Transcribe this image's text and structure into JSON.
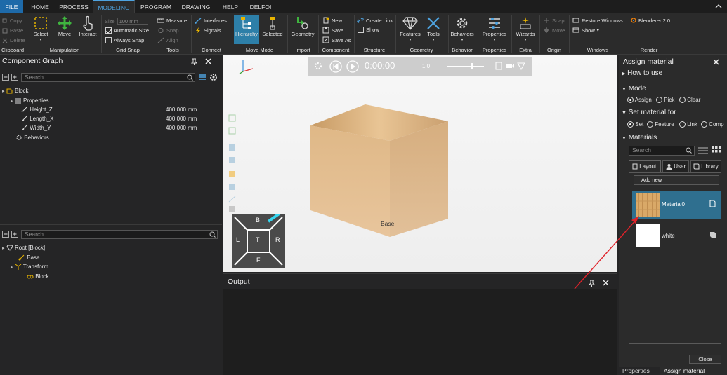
{
  "menu": {
    "tabs": [
      "FILE",
      "HOME",
      "PROCESS",
      "MODELING",
      "PROGRAM",
      "DRAWING",
      "HELP",
      "DELFOI"
    ]
  },
  "ribbon": {
    "clipboard": {
      "copy": "Copy",
      "paste": "Paste",
      "delete": "Delete",
      "group": "Clipboard"
    },
    "manipulation": {
      "select": "Select",
      "move": "Move",
      "interact": "Interact",
      "group": "Manipulation"
    },
    "grid_snap": {
      "size_label": "Size",
      "size_value": "100",
      "size_unit": "mm",
      "auto_size": "Automatic Size",
      "always_snap": "Always Snap",
      "group": "Grid Snap"
    },
    "tools": {
      "measure": "Measure",
      "snap": "Snap",
      "align": "Align",
      "group": "Tools"
    },
    "connect": {
      "interfaces": "Interfaces",
      "signals": "Signals",
      "group": "Connect"
    },
    "move_mode": {
      "hierarchy": "Hierarchy",
      "selected": "Selected",
      "group": "Move Mode"
    },
    "import": {
      "geometry": "Geometry",
      "group": "Import"
    },
    "component": {
      "new": "New",
      "save": "Save",
      "save_as": "Save As",
      "group": "Component"
    },
    "structure": {
      "create_link": "Create Link",
      "show": "Show",
      "group": "Structure"
    },
    "geometry": {
      "features": "Features",
      "tools": "Tools",
      "group": "Geometry"
    },
    "behavior": {
      "behaviors": "Behaviors",
      "group": "Behavior"
    },
    "properties": {
      "properties": "Properties",
      "group": "Properties"
    },
    "extra": {
      "wizards": "Wizards",
      "group": "Extra"
    },
    "origin": {
      "snap": "Snap",
      "move": "Move",
      "group": "Origin"
    },
    "windows": {
      "restore": "Restore Windows",
      "show": "Show",
      "group": "Windows"
    },
    "render": {
      "blenderer": "Blenderer 2.0",
      "group": "Render"
    }
  },
  "component_graph": {
    "title": "Component Graph",
    "search_placeholder": "Search...",
    "root": "Block",
    "properties": "Properties",
    "rows": [
      {
        "name": "Height_Z",
        "value": "400.000 mm"
      },
      {
        "name": "Length_X",
        "value": "400.000 mm"
      },
      {
        "name": "Width_Y",
        "value": "400.000 mm"
      }
    ],
    "behaviors": "Behaviors"
  },
  "cell_graph": {
    "search_placeholder": "Search...",
    "root": "Root [Block]",
    "base": "Base",
    "transform": "Transform",
    "block": "Block"
  },
  "viewport": {
    "time": "0:00:00",
    "speed": "1.0",
    "cube_label": "Base",
    "nav": {
      "b": "B",
      "l": "L",
      "t": "T",
      "r": "R",
      "f": "F"
    }
  },
  "output": {
    "title": "Output"
  },
  "assign_material": {
    "title": "Assign material",
    "how_to_use": "How to use",
    "mode": "Mode",
    "mode_options": [
      "Assign",
      "Pick",
      "Clear"
    ],
    "set_material_for": "Set material for",
    "set_options": [
      "Set",
      "Feature",
      "Link",
      "Comp"
    ],
    "materials": "Materials",
    "search_placeholder": "Search",
    "tabs": [
      "Layout",
      "User",
      "Library"
    ],
    "add_new": "Add new",
    "items": [
      "Material0",
      "white"
    ],
    "close": "Close",
    "bottom_tabs": [
      "Properties",
      "Assign material"
    ]
  },
  "colors": {
    "accent": "#2d7fa8",
    "file_tab": "#1e6aa9",
    "selection": "#2f6f8f",
    "arrow": "#e0222a",
    "cube": "#d8b185"
  }
}
